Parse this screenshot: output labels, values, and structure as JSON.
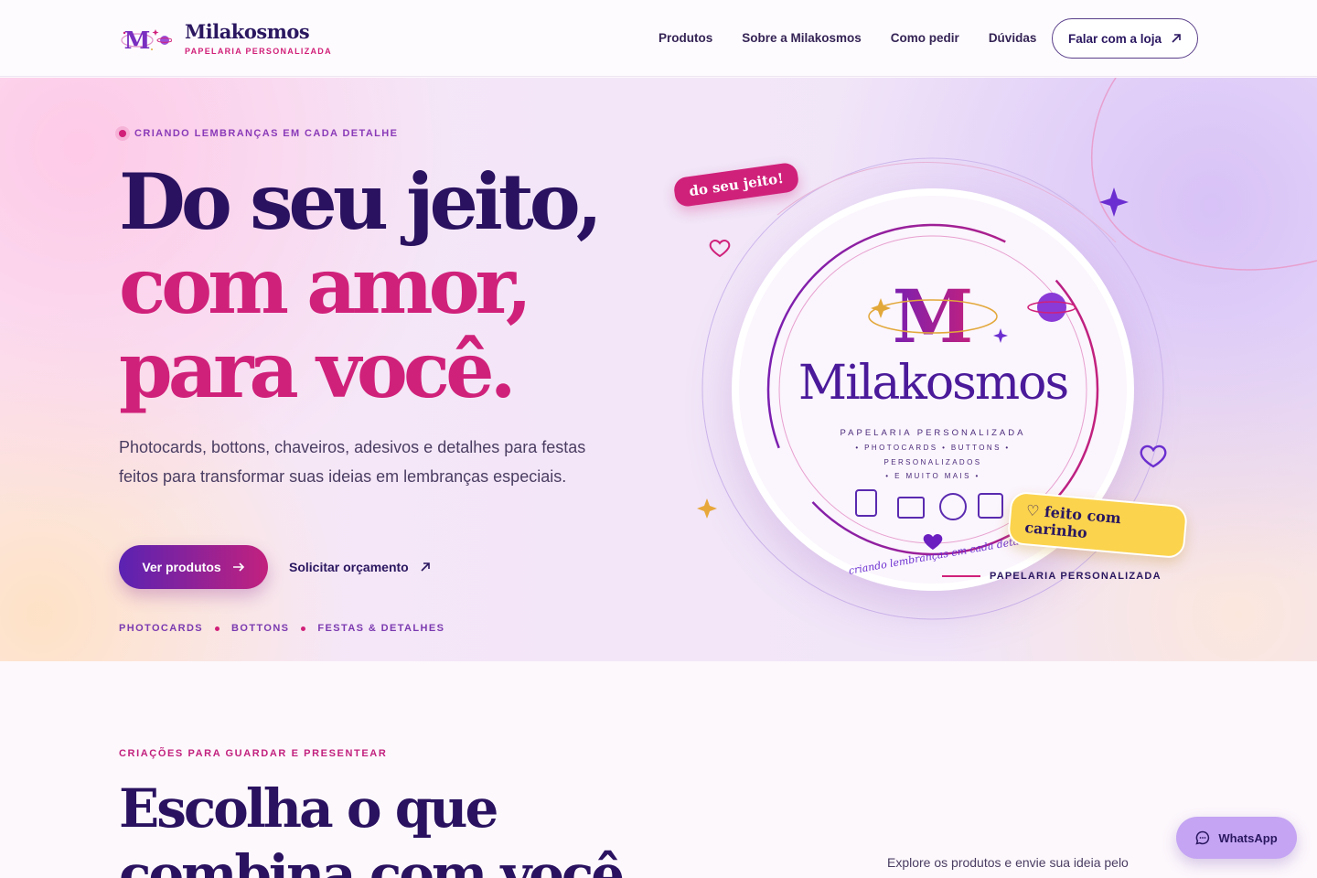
{
  "header": {
    "brand_name": "Milakosmos",
    "brand_tagline": "PAPELARIA PERSONALIZADA",
    "brand_mark_letter": "M",
    "nav": [
      "Produtos",
      "Sobre a Milakosmos",
      "Como pedir",
      "Dúvidas"
    ],
    "cta_label": "Falar com a loja"
  },
  "hero": {
    "eyebrow": "CRIANDO LEMBRANÇAS EM CADA DETALHE",
    "headline_line1": "Do seu jeito,",
    "headline_line2": "com amor,",
    "headline_line3": "para você.",
    "lead": "Photocards, bottons, chaveiros, adesivos e detalhes para festas feitos para transformar suas ideias em lembranças especiais.",
    "primary_button": "Ver produtos",
    "secondary_button": "Solicitar orçamento",
    "tags": [
      "PHOTOCARDS",
      "BOTTONS",
      "FESTAS & DETALHES"
    ],
    "sticker_top": "do seu jeito!",
    "sticker_bottom": "♡ feito com carinho",
    "caption": "PAPELARIA PERSONALIZADA"
  },
  "medallion": {
    "big_letter": "M",
    "name": "Milakosmos",
    "line1": "PAPELARIA PERSONALIZADA",
    "line2": "• PHOTOCARDS • BUTTONS •",
    "line3": "PERSONALIZADOS",
    "line4": "• E MUITO MAIS •",
    "script": "criando lembranças em cada detalhe"
  },
  "section": {
    "eyebrow": "CRIAÇÕES PARA GUARDAR E PRESENTEAR",
    "title_line1": "Escolha o que",
    "title_line2": "combina com você",
    "description": "Explore os produtos e envie sua ideia pelo"
  },
  "whatsapp": {
    "label": "WhatsApp"
  },
  "colors": {
    "deep_purple": "#2a1260",
    "magenta": "#d0217a",
    "violet": "#7b3ab0",
    "yellow": "#fbd34d",
    "lavender": "#c4a4f3"
  }
}
